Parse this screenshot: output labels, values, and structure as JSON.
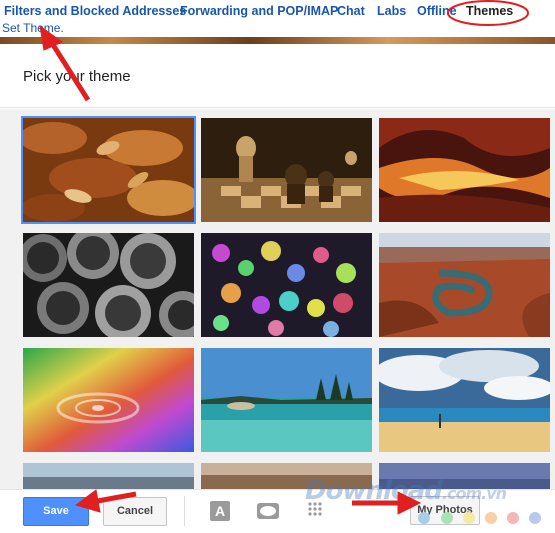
{
  "tabs": [
    {
      "label": "Filters and Blocked Addresses"
    },
    {
      "label": "Forwarding and POP/IMAP"
    },
    {
      "label": "Chat"
    },
    {
      "label": "Labs"
    },
    {
      "label": "Offline"
    },
    {
      "label": "Themes"
    }
  ],
  "breadcrumb": "Set Theme.",
  "dialog": {
    "title": "Pick your theme",
    "themes": [
      {
        "name": "autumn-leaves",
        "selected": true
      },
      {
        "name": "chess-pieces",
        "selected": false
      },
      {
        "name": "canyon",
        "selected": false
      },
      {
        "name": "metal-pipes",
        "selected": false
      },
      {
        "name": "bokeh-lights",
        "selected": false
      },
      {
        "name": "river-bend",
        "selected": false
      },
      {
        "name": "rainbow-water",
        "selected": false
      },
      {
        "name": "lake-shore",
        "selected": false
      },
      {
        "name": "beach-clouds",
        "selected": false
      }
    ]
  },
  "footer": {
    "save_label": "Save",
    "cancel_label": "Cancel",
    "my_photos_label": "My Photos",
    "icons": [
      "text-color-icon",
      "vignette-icon",
      "blur-icon"
    ]
  },
  "swatches": [
    "#a8cde8",
    "#a9e3b5",
    "#f5e9a4",
    "#f8cfa6",
    "#f4b6b6",
    "#b9c9ee",
    "#c9a8e0"
  ],
  "watermark": {
    "text": "Download",
    "suffix": ".com.vn"
  },
  "colors": {
    "link": "#1a55b0",
    "primary_button": "#4d90fe",
    "annotation": "#e02020"
  }
}
